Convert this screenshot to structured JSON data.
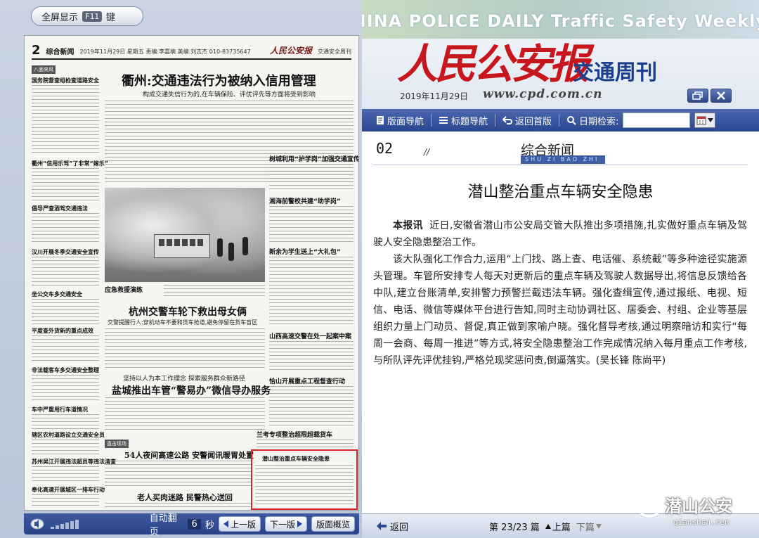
{
  "reader": {
    "fullscreen_label": "全屏显示",
    "fullscreen_key": "F11",
    "fullscreen_suffix": "键",
    "auto_flip_label": "自动翻页",
    "auto_flip_seconds": "6",
    "seconds_unit": "秒",
    "prev_edition": "上一版",
    "next_edition": "下一版",
    "overview": "版面概览"
  },
  "thumbnail": {
    "page_no": "2",
    "column": "综合新闻",
    "date_line": "2019年11月29日  星期五  责编:李嘉楠  美编:刘志杰  010-83735647",
    "logo_text": "人民公安报",
    "weekly": "交通安全周刊",
    "headline1": "衢州:交通违法行为被纳入信用管理",
    "subhead1": "构成交通失信行为的,在车辆保险、评优评先等方面将受到影响",
    "photo_caption": "应急救援演练",
    "headline2": "杭州交警车轮下救出母女俩",
    "subhead2": "交警提醒行人:穿机动车不要和货车抢道,避免停留在货车盲区",
    "pre_head3": "坚持以人为本工作理念  探索服务群众新路径",
    "headline3": "盐城推出车管“警易办”微信导办服务",
    "headline4": "54人夜间高速公路  安警闻讯暖胃处置",
    "headline5": "老人买肉迷路  民警热心送回",
    "side1": "树城利用“护学岗”加强交通宣传",
    "side2": "湘海前警校共建“助学岗”",
    "side3": "新余为学生送上“大礼包”",
    "side4": "山西高速交警在处一起案中案",
    "side5": "恰山开展重点工程督查行动",
    "side6": "兰考专项整治超限超载货车",
    "side7": "潜山整治重点车辆安全隐患",
    "tag1": "八面来风",
    "tag2": "直击现场",
    "left_col": [
      "国务院督查组检查道路安全",
      "衢州“信用乐驾”了非常“嫁乐”",
      "倡导严查酒驾交通违法",
      "汉川开展冬季交通安全宣传",
      "坐公交车多交通安全",
      "平度查外货新的重点成效",
      "非法载客车多交通安全整理",
      "车中严重用行车道情况",
      "辖区农村道路设立交通安全员",
      "苏州吴江开展违法超员等违法清查",
      "奉化高速开展城区一排车行动"
    ]
  },
  "masthead": {
    "en_title": "CHINA POLICE DAILY Traffic Safety Weekly",
    "cn_logo": "人民公安报",
    "cn_sub": "交通周刊",
    "date": "2019年11月29日",
    "site": "www.cpd.com.cn"
  },
  "nav": {
    "layout_nav": "版面导航",
    "title_nav": "标题导航",
    "home": "返回首版",
    "date_search": "日期检索:"
  },
  "page": {
    "number": "02",
    "section": "综合新闻",
    "pinyin": "SHU ZI BAO ZHI"
  },
  "article": {
    "title": "潜山整治重点车辆安全隐患",
    "lead": "本报讯",
    "p1": "近日,安徽省潜山市公安局交管大队推出多项措施,扎实做好重点车辆及驾驶人安全隐患整治工作。",
    "p2": "该大队强化工作合力,运用“上门找、路上查、电话催、系统截”等多种途径实施源头管理。车管所安排专人每天对更新后的重点车辆及驾驶人数据导出,将信息反馈给各中队,建立台账清单,安排警力预警拦截违法车辆。强化查缉宣传,通过报纸、电视、短信、电话、微信等媒体平台进行告知,同时主动协调社区、居委会、村组、企业等基层组织力量上门动员、督促,真正做到家喻户晓。强化督导考核,通过明察暗访和实行“每周一会商、每周一推进”等方式,将安全隐患整治工作完成情况纳入每月重点工作考核,与所队评先评优挂钩,严格兑现奖惩问责,倒逼落实。(吴长锋  陈尚平)"
  },
  "footer": {
    "back": "返回",
    "page_count": "第 23/23 篇",
    "prev": "上篇",
    "next": "下篇"
  },
  "watermark": {
    "text": "潜山公安",
    "url": "qianshan.ren"
  },
  "colors": {
    "nav_blue": "#2b4690",
    "logo_red": "#c8161d",
    "highlight_red": "#dd2222",
    "sub_blue": "#1b3f8f"
  }
}
